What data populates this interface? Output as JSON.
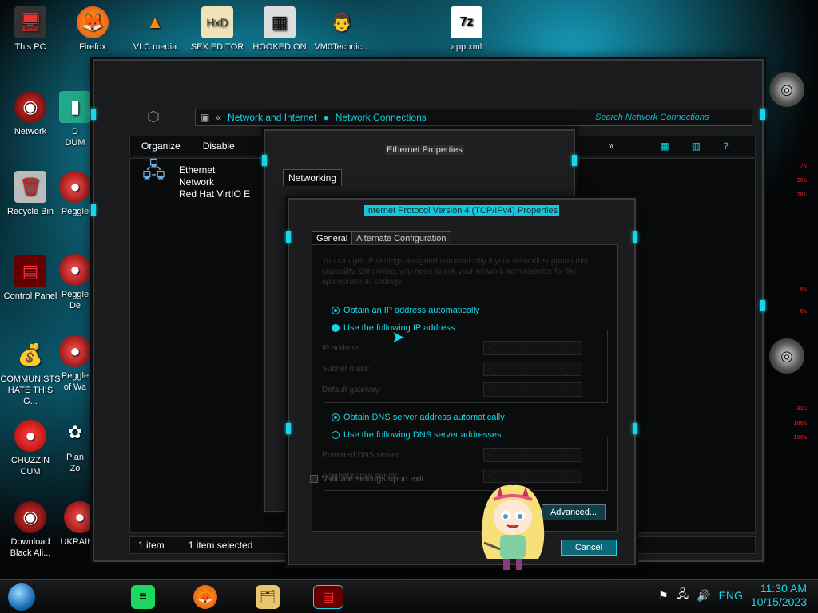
{
  "desktop_icons": [
    {
      "label": "This PC"
    },
    {
      "label": "Firefox"
    },
    {
      "label": "VLC media"
    },
    {
      "label": "SEX EDITOR"
    },
    {
      "label": "HOOKED ON"
    },
    {
      "label": "VM0Technic..."
    },
    {
      "label": "app.xml"
    },
    {
      "label": "Network"
    },
    {
      "label": "D\nDUM"
    },
    {
      "label": "Recycle Bin"
    },
    {
      "label": "Peggle"
    },
    {
      "label": "Control Panel"
    },
    {
      "label": "Peggle\nDe"
    },
    {
      "label": "COMMUNISTS\nHATE THIS G..."
    },
    {
      "label": "Peggle\nof Wa"
    },
    {
      "label": "CHUZZIN\nCUM"
    },
    {
      "label": "Plan\nZo"
    },
    {
      "label": "Download\nBlack Ali..."
    },
    {
      "label": "UKRAINE"
    }
  ],
  "explorer": {
    "breadcrumb_root": "Network and Internet",
    "breadcrumb_current": "Network Connections",
    "search_placeholder": "Search Network Connections",
    "toolbar": {
      "organize": "Organize",
      "disable": "Disable",
      "more": "»"
    },
    "item": {
      "name": "Ethernet",
      "status": "Network",
      "adapter": "Red Hat VirtIO E"
    },
    "status": {
      "count": "1 item",
      "selected": "1 item selected"
    }
  },
  "ethernet_properties": {
    "title": "Ethernet Properties",
    "tab": "Networking"
  },
  "ipv4": {
    "title": "Internet Protocol Version 4 (TCP/IPv4) Properties",
    "tabs": {
      "general": "General",
      "alternate": "Alternate Configuration"
    },
    "intro": "You can get IP settings assigned automatically if your network supports this capability. Otherwise, you need to ask your network administrator for the appropriate IP settings.",
    "obtain_ip": "Obtain an IP address automatically",
    "use_ip": "Use the following IP address:",
    "ip_label": "IP address:",
    "mask_label": "Subnet mask:",
    "gateway_label": "Default gateway:",
    "obtain_dns": "Obtain DNS server address automatically",
    "use_dns": "Use the following DNS server addresses:",
    "pref_dns_label": "Preferred DNS server:",
    "alt_dns_label": "Alternate DNS server:",
    "ip_placeholder": ".   .   .",
    "validate": "Validate settings upon exit",
    "advanced": "Advanced...",
    "cancel": "Cancel"
  },
  "gauges": [
    "7%",
    "20%",
    "28%",
    "0%",
    "0%",
    "31%",
    "100%",
    "100%"
  ],
  "taskbar": {
    "language": "ENG",
    "time": "11:30 AM",
    "date": "10/15/2023"
  },
  "colors": {
    "accent": "#18d6e8",
    "alert": "#e02020"
  }
}
